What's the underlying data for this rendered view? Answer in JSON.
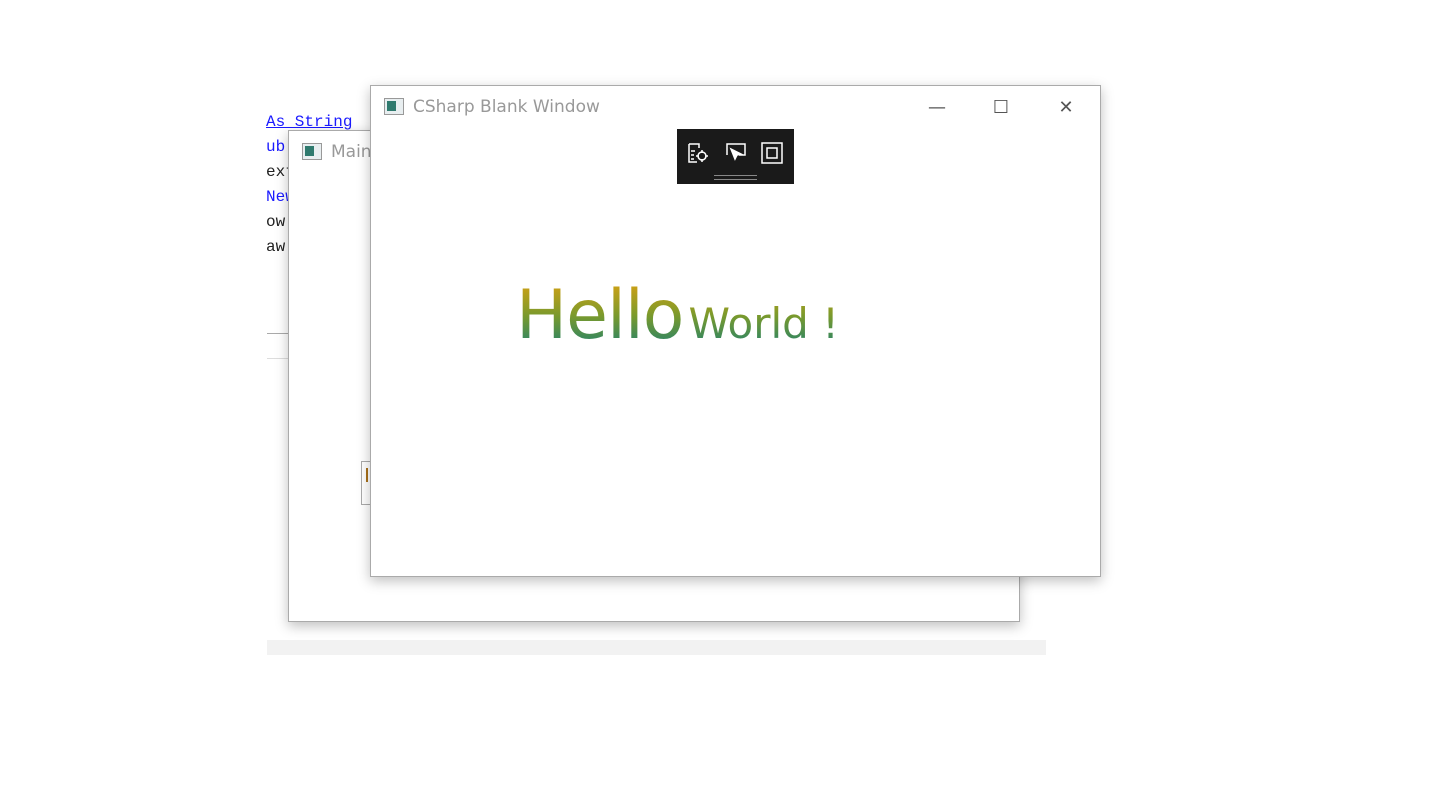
{
  "code_editor": {
    "lines": [
      {
        "text": "As String",
        "color": "blue"
      },
      {
        "text": "ub",
        "color": "blue"
      },
      {
        "text": "ext",
        "color": "black"
      },
      {
        "text": "New",
        "color": "blue"
      },
      {
        "text": "ow",
        "color": "black"
      },
      {
        "text": "aw",
        "color": "black"
      }
    ]
  },
  "main_window": {
    "title": "Main"
  },
  "csharp_window": {
    "title": "CSharp Blank Window",
    "controls": {
      "minimize": "—",
      "maximize": "☐",
      "close": "✕"
    },
    "toolbar": {
      "icons": [
        "live-visual-tree-icon",
        "select-element-icon",
        "display-layout-adorners-icon"
      ]
    },
    "content": {
      "hello": "Hello",
      "world": "World !"
    },
    "gradient": {
      "top": "#e3a20f",
      "bottom": "#0f7d7c"
    }
  }
}
